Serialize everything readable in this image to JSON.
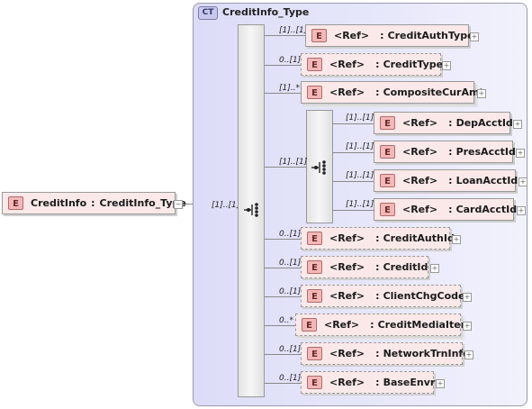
{
  "root": {
    "badge": "E",
    "name": "CreditInfo",
    "sep": ":",
    "type": "CreditInfo_Type",
    "toggle": "−"
  },
  "complex_type": {
    "badge": "CT",
    "name": "CreditInfo_Type"
  },
  "root_cardinality": "[1]..[1]",
  "inner_seq_cardinality": "[1]..[1]",
  "children": [
    {
      "name": "CreditAuthType",
      "ref": "<Ref>",
      "card": "[1]..[1]",
      "badge": "E",
      "expand": "+"
    },
    {
      "name": "CreditType",
      "ref": "<Ref>",
      "card": "0..[1]",
      "badge": "E",
      "expand": "+"
    },
    {
      "name": "CompositeCurAmt",
      "ref": "<Ref>",
      "card": "[1]..*",
      "badge": "E",
      "expand": "+"
    },
    {
      "name": "CreditAuthId",
      "ref": "<Ref>",
      "card": "0..[1]",
      "badge": "E",
      "expand": "+"
    },
    {
      "name": "CreditId",
      "ref": "<Ref>",
      "card": "0..[1]",
      "badge": "E",
      "expand": "+"
    },
    {
      "name": "ClientChgCode",
      "ref": "<Ref>",
      "card": "0..[1]",
      "badge": "E",
      "expand": "+"
    },
    {
      "name": "CreditMediaItem",
      "ref": "<Ref>",
      "card": "0..*",
      "badge": "E",
      "expand": "+"
    },
    {
      "name": "NetworkTrnInfo",
      "ref": "<Ref>",
      "card": "0..[1]",
      "badge": "E",
      "expand": "+"
    },
    {
      "name": "BaseEnvr",
      "ref": "<Ref>",
      "card": "0..[1]",
      "badge": "E",
      "expand": "+"
    }
  ],
  "choice_children": [
    {
      "name": "DepAcctId",
      "ref": "<Ref>",
      "card": "[1]..[1]",
      "badge": "E",
      "expand": "+"
    },
    {
      "name": "PresAcctId",
      "ref": "<Ref>",
      "card": "[1]..[1]",
      "badge": "E",
      "expand": "+"
    },
    {
      "name": "LoanAcctId",
      "ref": "<Ref>",
      "card": "[1]..[1]",
      "badge": "E",
      "expand": "+"
    },
    {
      "name": "CardAcctId",
      "ref": "<Ref>",
      "card": "[1]..[1]",
      "badge": "E",
      "expand": "+"
    }
  ]
}
